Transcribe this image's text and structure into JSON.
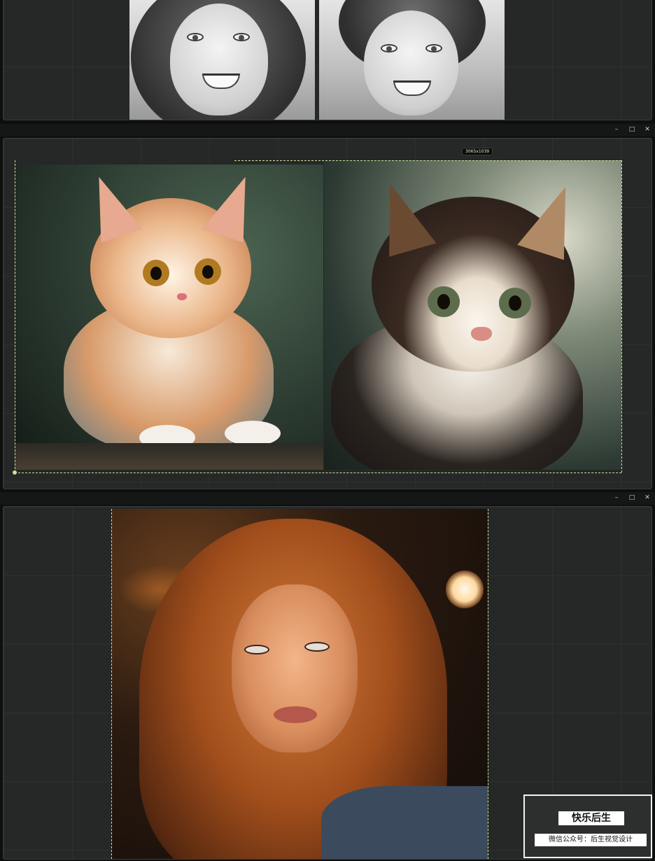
{
  "windows": {
    "minimize_glyph": "–",
    "maximize_glyph": "□",
    "close_glyph": "✕"
  },
  "selection": {
    "size_label": "3065x1039"
  },
  "watermark": {
    "title": "快乐后生",
    "subtitle": "微信公众号：后生视觉设计"
  },
  "colors": {
    "canvas_bg": "#262727",
    "selection_dash": "#c8e39a"
  },
  "icons": [
    "minimize-icon",
    "maximize-icon",
    "close-icon"
  ]
}
